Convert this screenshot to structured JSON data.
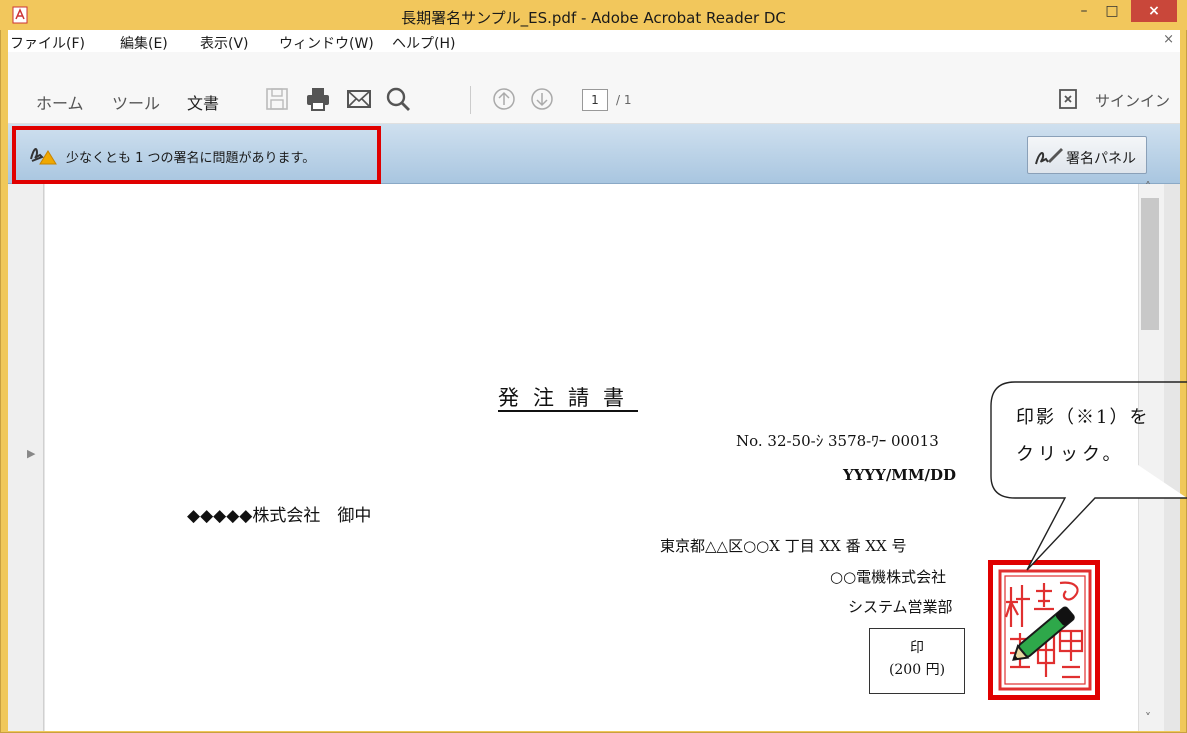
{
  "window": {
    "title": "長期署名サンプル_ES.pdf - Adobe Acrobat Reader DC",
    "minimize_glyph": "–",
    "maximize_glyph": "□",
    "close_glyph": "×"
  },
  "menu": {
    "items": [
      {
        "label": "ファイル(F)"
      },
      {
        "label": "編集(E)"
      },
      {
        "label": "表示(V)"
      },
      {
        "label": "ウィンドウ(W)"
      },
      {
        "label": "ヘルプ(H)"
      }
    ],
    "close_glyph": "×"
  },
  "toolbar": {
    "home": "ホーム",
    "tools": "ツール",
    "document": "文書",
    "icons": [
      "save-icon",
      "print-icon",
      "mail-icon",
      "search-icon",
      "page-up-icon",
      "page-down-icon",
      "sign-in-icon"
    ],
    "page_current": "1",
    "page_total": "/ 1",
    "signin": "サインイン"
  },
  "signature_bar": {
    "message": "少なくとも 1 つの署名に問題があります。",
    "panel_button": "署名パネル",
    "highlight_color": "#e00000"
  },
  "document": {
    "title": "発注請書",
    "number": "No.  32-50-ｼ 3578-ﾜｰ 00013",
    "date": "YYYY/MM/DD",
    "recipient": "◆◆◆◆◆株式会社　御中",
    "address": "東京都△△区○○X 丁目 XX 番 XX 号",
    "company": "○○電機株式会社",
    "department": "システム営業部",
    "stamp_label": "印",
    "stamp_fee": "(200 円)"
  },
  "callout": {
    "line1": "印影（※1）を",
    "line2": "クリック。"
  },
  "colors": {
    "titlebar": "#f2c75c",
    "close_button": "#c9473a",
    "signature_bar": "#a9c6e0",
    "seal_red": "#e03030"
  }
}
